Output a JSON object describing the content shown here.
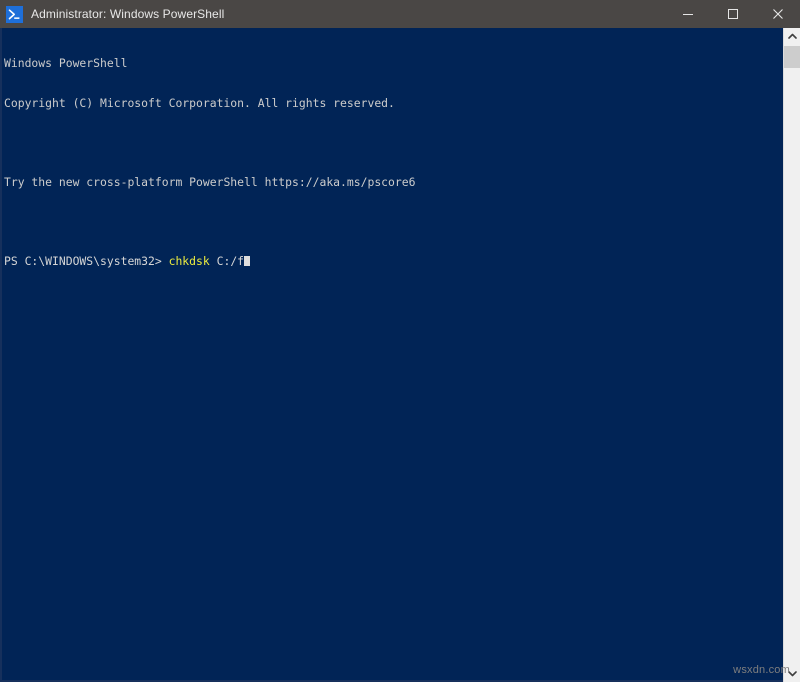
{
  "window": {
    "title": "Administrator: Windows PowerShell",
    "app_icon": "powershell-icon",
    "titlebar_color": "#4a4745",
    "console_background": "#012456",
    "console_foreground": "#cccccc",
    "accent_yellow": "#eeed3f",
    "controls": {
      "minimize": "minimize-icon",
      "maximize": "maximize-icon",
      "close": "close-icon"
    }
  },
  "console": {
    "lines": [
      {
        "text": "Windows PowerShell",
        "color": "white"
      },
      {
        "text": "Copyright (C) Microsoft Corporation. All rights reserved.",
        "color": "white"
      },
      {
        "text": "",
        "color": "white"
      },
      {
        "text": "Try the new cross-platform PowerShell https://aka.ms/pscore6",
        "color": "white"
      },
      {
        "text": "",
        "color": "white"
      }
    ],
    "prompt": {
      "path": "PS C:\\WINDOWS\\system32>",
      "command": "chkdsk",
      "arguments": " C:/f",
      "cursor": "block-cursor"
    }
  },
  "scrollbar": {
    "up_arrow": "chevron-up-icon",
    "down_arrow": "chevron-down-icon",
    "thumb": "scrollbar-thumb"
  },
  "watermark": {
    "text": "wsxdn.com"
  }
}
